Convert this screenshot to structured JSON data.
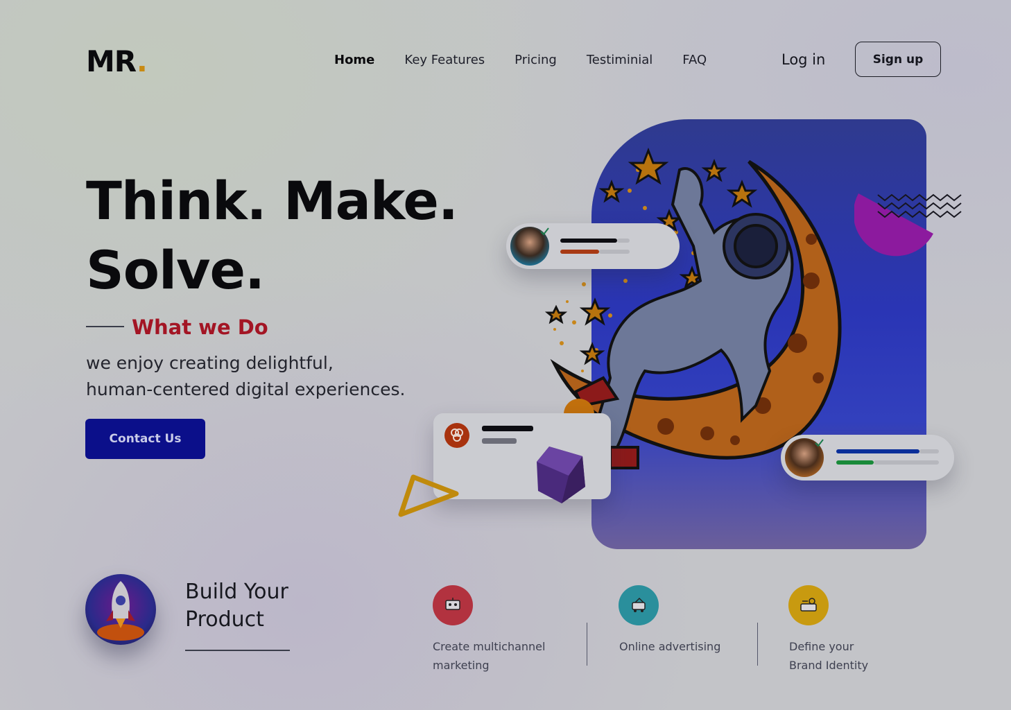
{
  "header": {
    "logo_text": "MR",
    "logo_dot": ".",
    "nav": [
      {
        "label": "Home",
        "active": true
      },
      {
        "label": "Key Features"
      },
      {
        "label": "Pricing"
      },
      {
        "label": "Testiminial"
      },
      {
        "label": "FAQ"
      }
    ],
    "login_label": "Log in",
    "signup_label": "Sign up"
  },
  "hero": {
    "headline_line1": "Think. Make.",
    "headline_line2": "Solve.",
    "section_label": "What we Do",
    "description_line1": "we enjoy creating delightful,",
    "description_line2": "human-centered digital experiences.",
    "cta_label": "Contact Us"
  },
  "services": {
    "build_title_line1": "Build Your",
    "build_title_line2": "Product",
    "items": [
      {
        "line1": "Create multichannel",
        "line2": "marketing",
        "icon": "marketing-icon",
        "color": "#b2323f"
      },
      {
        "line1": "Online advertising",
        "line2": "",
        "icon": "advertising-icon",
        "color": "#2a8f9c"
      },
      {
        "line1": "Define your",
        "line2": "Brand Identity",
        "icon": "brand-identity-icon",
        "color": "#c89a10"
      }
    ]
  },
  "colors": {
    "accent_blue": "#0b0f8a",
    "accent_red": "#a31524",
    "logo_dot": "#c88a12"
  }
}
